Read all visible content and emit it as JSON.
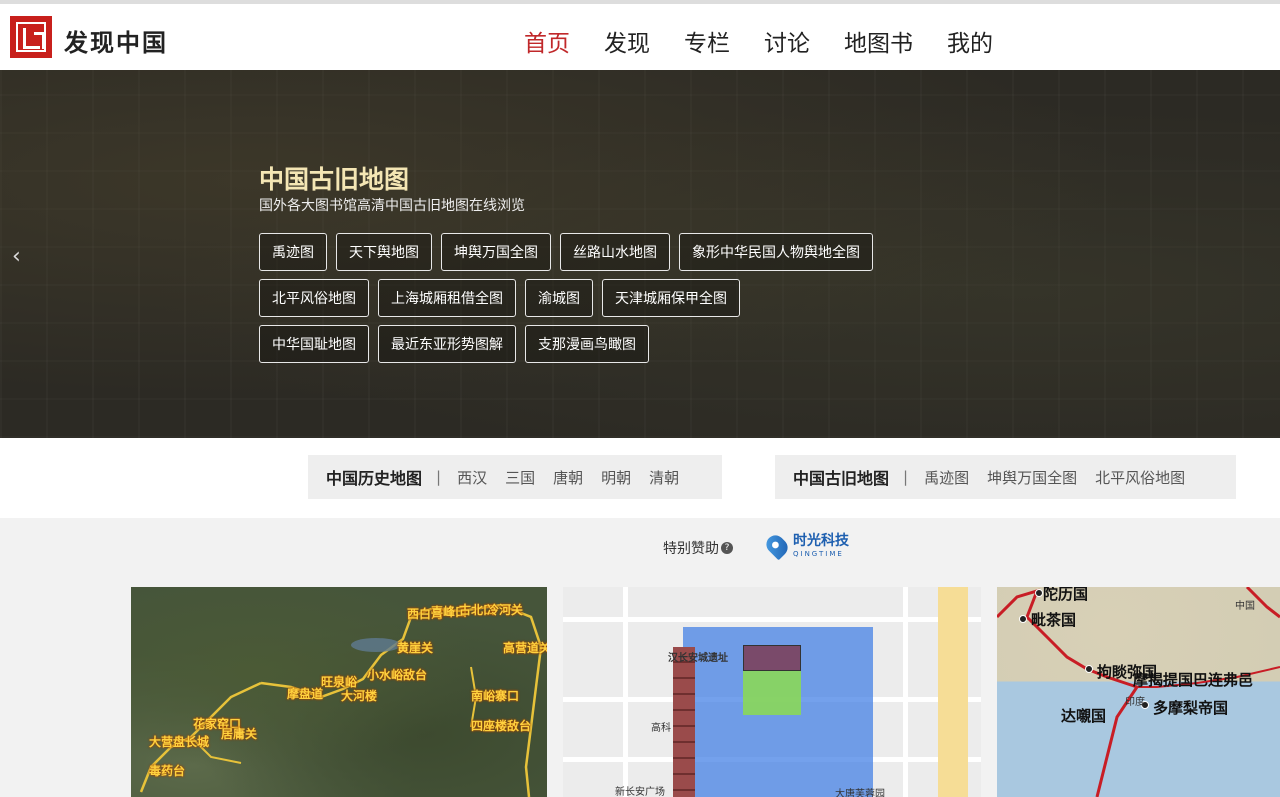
{
  "header": {
    "brand": "发现中国",
    "nav": [
      "首页",
      "发现",
      "专栏",
      "讨论",
      "地图书",
      "我的"
    ]
  },
  "hero": {
    "arrow": "‹",
    "title": "中国古旧地图",
    "subtitle": "国外各大图书馆高清中国古旧地图在线浏览",
    "tag_rows": [
      [
        "禹迹图",
        "天下舆地图",
        "坤舆万国全图",
        "丝路山水地图",
        "象形中华民国人物舆地全图"
      ],
      [
        "北平风俗地图",
        "上海城厢租借全图",
        "渝城图",
        "天津城厢保甲全图"
      ],
      [
        "中华国耻地图",
        "最近东亚形势图解",
        "支那漫画鸟瞰图"
      ]
    ]
  },
  "quick": {
    "history": {
      "title": "中国历史地图",
      "sep": "|",
      "links": [
        "西汉",
        "三国",
        "唐朝",
        "明朝",
        "清朝"
      ]
    },
    "ancient": {
      "title": "中国古旧地图",
      "sep": "|",
      "links": [
        "禹迹图",
        "坤舆万国全图",
        "北平风俗地图"
      ]
    }
  },
  "sponsor": {
    "label": "特别赞助",
    "help": "?",
    "logo_cn": "时光科技",
    "logo_en": "QINGTIME"
  },
  "cards": {
    "card1_labels": [
      "西白河",
      "喜峰口",
      "古北口",
      "冷河关",
      "黄崖关",
      "高营道关",
      "小水峪敌台",
      "旺泉峪",
      "大河楼",
      "摩盘道",
      "南峪寨口",
      "花家窑口",
      "居庸关",
      "四座楼敌台",
      "大营盘长城",
      "毒药台"
    ],
    "card2_labels": [
      "汉长安城遗址",
      "新长安广场",
      "高科",
      "大唐芙蓉园"
    ],
    "card3_labels": [
      "陀历国",
      "毗茶国",
      "拘睒弥国",
      "摩揭提国巴连弗邑",
      "达嚫国",
      "多摩梨帝国",
      "印度",
      "中国"
    ]
  }
}
